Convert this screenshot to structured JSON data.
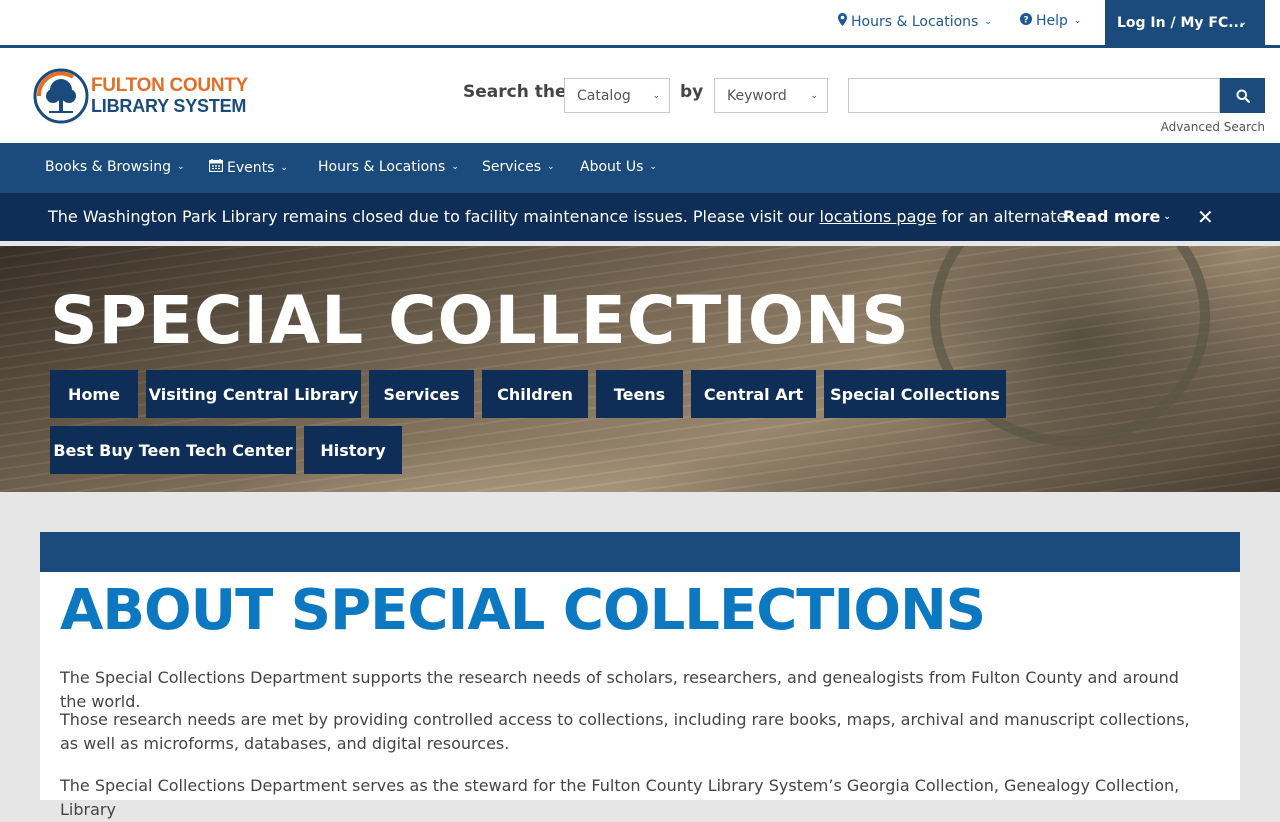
{
  "utility": {
    "hours_label": "Hours & Locations",
    "help_label": "Help",
    "login_label": "Log In / My FC..."
  },
  "logo": {
    "line1": "FULTON COUNTY",
    "line2": "LIBRARY SYSTEM"
  },
  "search": {
    "label": "Search the",
    "scope_value": "Catalog",
    "by_label": "by",
    "field_value": "Keyword",
    "query": "",
    "advanced_label": "Advanced Search"
  },
  "nav": {
    "items": [
      {
        "label": "Books & Browsing"
      },
      {
        "label": "Events"
      },
      {
        "label": "Hours & Locations"
      },
      {
        "label": "Services"
      },
      {
        "label": "About Us"
      }
    ]
  },
  "alert": {
    "text_before": "The Washington Park Library remains closed due to facility maintenance issues. Please visit our ",
    "link_text": "locations page",
    "text_after": " for an alternate",
    "read_more": "Read more",
    "close": "✕"
  },
  "hero": {
    "title": "SPECIAL COLLECTIONS",
    "tabs": [
      {
        "label": "Home"
      },
      {
        "label": "Visiting Central Library"
      },
      {
        "label": "Services"
      },
      {
        "label": "Children"
      },
      {
        "label": "Teens"
      },
      {
        "label": "Central Art"
      },
      {
        "label": "Special Collections"
      },
      {
        "label": "Best Buy Teen Tech Center"
      },
      {
        "label": "History"
      }
    ]
  },
  "content": {
    "title": "ABOUT SPECIAL COLLECTIONS",
    "paragraphs": [
      "The Special Collections Department supports the research needs of scholars, researchers, and genealogists from Fulton County and around the world.",
      "Those research needs are met by providing controlled access to collections, including rare books, maps, archival and manuscript collections, as well as microforms, databases, and digital resources.",
      "The Special Collections Department serves as the steward for the Fulton County Library System’s Georgia Collection, Genealogy Collection, Library"
    ]
  },
  "colors": {
    "primary_blue": "#1b4b7d",
    "dark_navy": "#0f2e57",
    "accent_orange": "#e26f25",
    "heading_blue": "#0b78c1"
  }
}
